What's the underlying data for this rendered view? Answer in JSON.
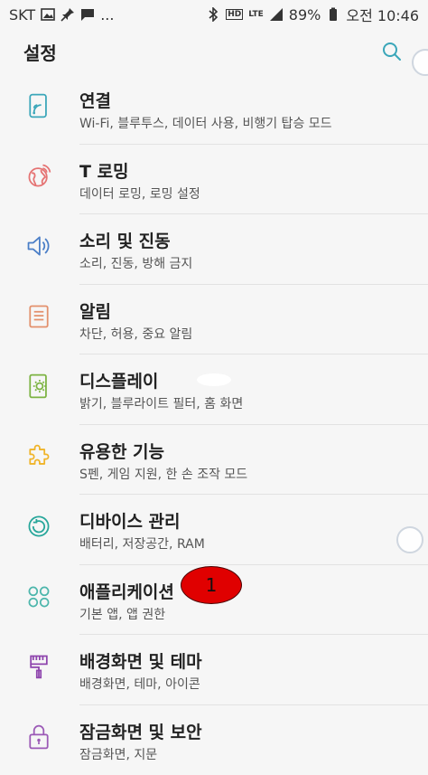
{
  "status_bar": {
    "carrier": "SKT",
    "dots": "...",
    "hd": "HD",
    "lte": "LTE",
    "battery": "89%",
    "time": "오전 10:46"
  },
  "header": {
    "title": "설정"
  },
  "items": [
    {
      "title": "연결",
      "subtitle": "Wi-Fi, 블루투스, 데이터 사용, 비행기 탑승 모드",
      "icon": "connection-icon",
      "color": "#3aa6b9"
    },
    {
      "title": "T 로밍",
      "subtitle": "데이터 로밍, 로밍 설정",
      "icon": "globe-icon",
      "color": "#e57373"
    },
    {
      "title": "소리 및 진동",
      "subtitle": "소리, 진동, 방해 금지",
      "icon": "speaker-icon",
      "color": "#4a7ec7"
    },
    {
      "title": "알림",
      "subtitle": "차단, 허용, 중요 알림",
      "icon": "notification-icon",
      "color": "#e3906c"
    },
    {
      "title": "디스플레이",
      "subtitle": "밝기, 블루라이트 필터, 홈 화면",
      "icon": "display-icon",
      "color": "#7cb342"
    },
    {
      "title": "유용한 기능",
      "subtitle": "S펜, 게임 지원, 한 손 조작 모드",
      "icon": "puzzle-icon",
      "color": "#f0b429"
    },
    {
      "title": "디바이스 관리",
      "subtitle": "배터리, 저장공간, RAM",
      "icon": "device-care-icon",
      "color": "#26a69a"
    },
    {
      "title": "애플리케이션",
      "subtitle": "기본 앱, 앱 권한",
      "icon": "apps-icon",
      "color": "#4db6ac"
    },
    {
      "title": "배경화면 및 테마",
      "subtitle": "배경화면, 테마, 아이콘",
      "icon": "brush-icon",
      "color": "#8e44ad"
    },
    {
      "title": "잠금화면 및 보안",
      "subtitle": "잠금화면, 지문",
      "icon": "lock-icon",
      "color": "#9b59b6"
    }
  ],
  "annotation": {
    "number": "1"
  }
}
